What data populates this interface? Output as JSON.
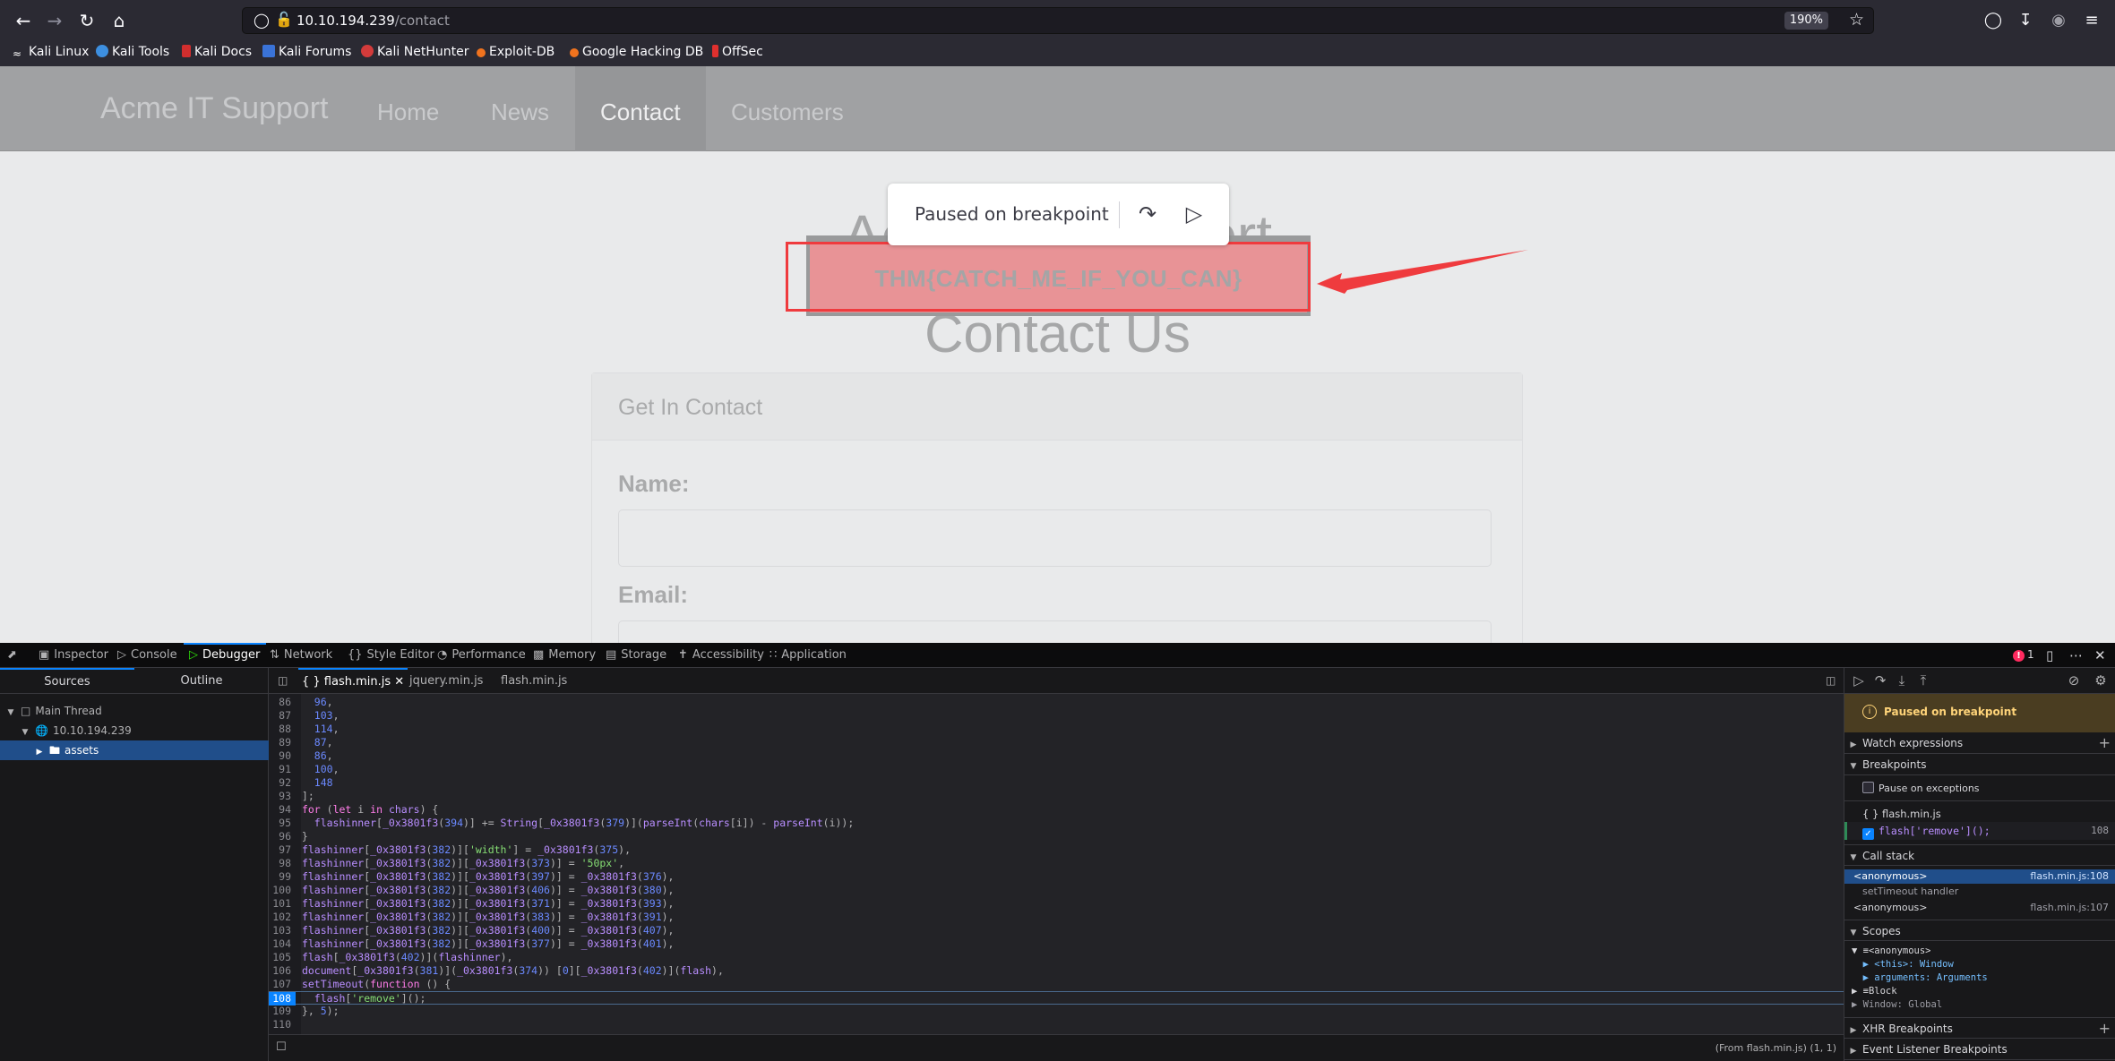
{
  "browser": {
    "url_host": "10.10.194.239",
    "url_path": "/contact",
    "zoom_level": "190%",
    "bookmarks": [
      {
        "label": "Kali Linux",
        "color": "#ffffff"
      },
      {
        "label": "Kali Tools",
        "color": "#3d8fe0"
      },
      {
        "label": "Kali Docs",
        "color": "#d22e2e"
      },
      {
        "label": "Kali Forums",
        "color": "#3a73d8"
      },
      {
        "label": "Kali NetHunter",
        "color": "#d33b3b"
      },
      {
        "label": "Exploit-DB",
        "color": "#f0731e"
      },
      {
        "label": "Google Hacking DB",
        "color": "#f0731e"
      },
      {
        "label": "OffSec",
        "color": "#e0302e"
      }
    ]
  },
  "site": {
    "brand": "Acme IT Support",
    "nav": [
      "Home",
      "News",
      "Contact",
      "Customers"
    ],
    "active_nav": "Contact",
    "hero_title": "Acme IT Support",
    "hero_subtitle": "Contact Us",
    "flag_text": "THM{CATCH_ME_IF_YOU_CAN}",
    "card_title": "Get In Contact",
    "name_label": "Name:",
    "email_label": "Email:",
    "name_value": "",
    "email_value": ""
  },
  "paused_overlay": {
    "label": "Paused on breakpoint"
  },
  "devtools": {
    "tabs": [
      "Inspector",
      "Console",
      "Debugger",
      "Network",
      "Style Editor",
      "Performance",
      "Memory",
      "Storage",
      "Accessibility",
      "Application"
    ],
    "active_tab": "Debugger",
    "error_count": "1",
    "sources_tabs": [
      "Sources",
      "Outline"
    ],
    "file_tabs": [
      {
        "label": "{ } flash.min.js",
        "active": true
      },
      {
        "label": "jquery.min.js",
        "active": false
      },
      {
        "label": "flash.min.js",
        "active": false
      }
    ],
    "tree": [
      {
        "label": "Main Thread"
      },
      {
        "label": "10.10.194.239"
      },
      {
        "label": "assets"
      }
    ],
    "code": [
      {
        "n": "86",
        "text": "  96,"
      },
      {
        "n": "87",
        "text": "  103,"
      },
      {
        "n": "88",
        "text": "  114,"
      },
      {
        "n": "89",
        "text": "  87,"
      },
      {
        "n": "90",
        "text": "  86,"
      },
      {
        "n": "91",
        "text": "  100,"
      },
      {
        "n": "92",
        "text": "  148"
      },
      {
        "n": "93",
        "text": "];"
      },
      {
        "n": "94",
        "text": "for (let i in chars) {"
      },
      {
        "n": "95",
        "text": "  flashinner[_0x3801f3(394)] += String[_0x3801f3(379)](parseInt(chars[i]) - parseInt(i));"
      },
      {
        "n": "96",
        "text": "}"
      },
      {
        "n": "97",
        "text": "flashinner[_0x3801f3(382)]['width'] = _0x3801f3(375),"
      },
      {
        "n": "98",
        "text": "flashinner[_0x3801f3(382)][_0x3801f3(373)] = '50px',"
      },
      {
        "n": "99",
        "text": "flashinner[_0x3801f3(382)][_0x3801f3(397)] = _0x3801f3(376),"
      },
      {
        "n": "100",
        "text": "flashinner[_0x3801f3(382)][_0x3801f3(406)] = _0x3801f3(380),"
      },
      {
        "n": "101",
        "text": "flashinner[_0x3801f3(382)][_0x3801f3(371)] = _0x3801f3(393),"
      },
      {
        "n": "102",
        "text": "flashinner[_0x3801f3(382)][_0x3801f3(383)] = _0x3801f3(391),"
      },
      {
        "n": "103",
        "text": "flashinner[_0x3801f3(382)][_0x3801f3(400)] = _0x3801f3(407),"
      },
      {
        "n": "104",
        "text": "flashinner[_0x3801f3(382)][_0x3801f3(377)] = _0x3801f3(401),"
      },
      {
        "n": "105",
        "text": "flash[_0x3801f3(402)](flashinner),"
      },
      {
        "n": "106",
        "text": "document[_0x3801f3(381)](_0x3801f3(374)) [0][_0x3801f3(402)](flash),"
      },
      {
        "n": "107",
        "text": "setTimeout(function () {"
      },
      {
        "n": "108",
        "text": "  flash['remove']();"
      },
      {
        "n": "109",
        "text": "}, 5);"
      },
      {
        "n": "110",
        "text": ""
      }
    ],
    "current_line": "108",
    "footer_position": "(From flash.min.js)  (1, 1)",
    "right_pane": {
      "paused_label": "Paused on breakpoint",
      "watch_label": "Watch expressions",
      "breakpoints_label": "Breakpoints",
      "pause_on_exceptions": "Pause on exceptions",
      "pause_on_exceptions_checked": false,
      "bp_file": "{ } flash.min.js",
      "bp_code": "flash['remove']();",
      "bp_line": "108",
      "bp_enabled": true,
      "callstack_label": "Call stack",
      "callstack": [
        {
          "name": "<anonymous>",
          "loc": "flash.min.js:108",
          "selected": true
        },
        {
          "name": "setTimeout handler",
          "loc": "",
          "selected": false
        },
        {
          "name": "<anonymous>",
          "loc": "flash.min.js:107",
          "selected": false
        }
      ],
      "scopes_label": "Scopes",
      "scopes": [
        "▼ ≡<anonymous>",
        "  ▶ <this>: Window",
        "  ▶ arguments: Arguments",
        "▶ ≡Block",
        "▶ Window: Global"
      ],
      "xhr_label": "XHR Breakpoints",
      "event_label": "Event Listener Breakpoints"
    }
  },
  "colors": {
    "annotation_red": "#ef3b3e",
    "devtools_accent": "#0a84ff",
    "debugger_green": "#30e60b",
    "paused_banner": "#4a3d21"
  }
}
